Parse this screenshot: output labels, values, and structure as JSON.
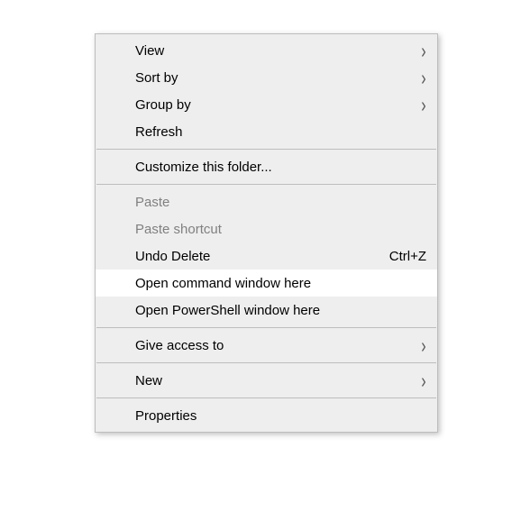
{
  "menu": {
    "items": [
      {
        "label": "View",
        "submenu": true,
        "disabled": false,
        "highlighted": false
      },
      {
        "label": "Sort by",
        "submenu": true,
        "disabled": false,
        "highlighted": false
      },
      {
        "label": "Group by",
        "submenu": true,
        "disabled": false,
        "highlighted": false
      },
      {
        "label": "Refresh",
        "submenu": false,
        "disabled": false,
        "highlighted": false
      },
      {
        "separator": true
      },
      {
        "label": "Customize this folder...",
        "submenu": false,
        "disabled": false,
        "highlighted": false
      },
      {
        "separator": true
      },
      {
        "label": "Paste",
        "submenu": false,
        "disabled": true,
        "highlighted": false
      },
      {
        "label": "Paste shortcut",
        "submenu": false,
        "disabled": true,
        "highlighted": false
      },
      {
        "label": "Undo Delete",
        "shortcut": "Ctrl+Z",
        "submenu": false,
        "disabled": false,
        "highlighted": false
      },
      {
        "label": "Open command window here",
        "submenu": false,
        "disabled": false,
        "highlighted": true
      },
      {
        "label": "Open PowerShell window here",
        "submenu": false,
        "disabled": false,
        "highlighted": false
      },
      {
        "separator": true
      },
      {
        "label": "Give access to",
        "submenu": true,
        "disabled": false,
        "highlighted": false
      },
      {
        "separator": true
      },
      {
        "label": "New",
        "submenu": true,
        "disabled": false,
        "highlighted": false
      },
      {
        "separator": true
      },
      {
        "label": "Properties",
        "submenu": false,
        "disabled": false,
        "highlighted": false
      }
    ]
  },
  "glyphs": {
    "chevron_right": "›"
  }
}
